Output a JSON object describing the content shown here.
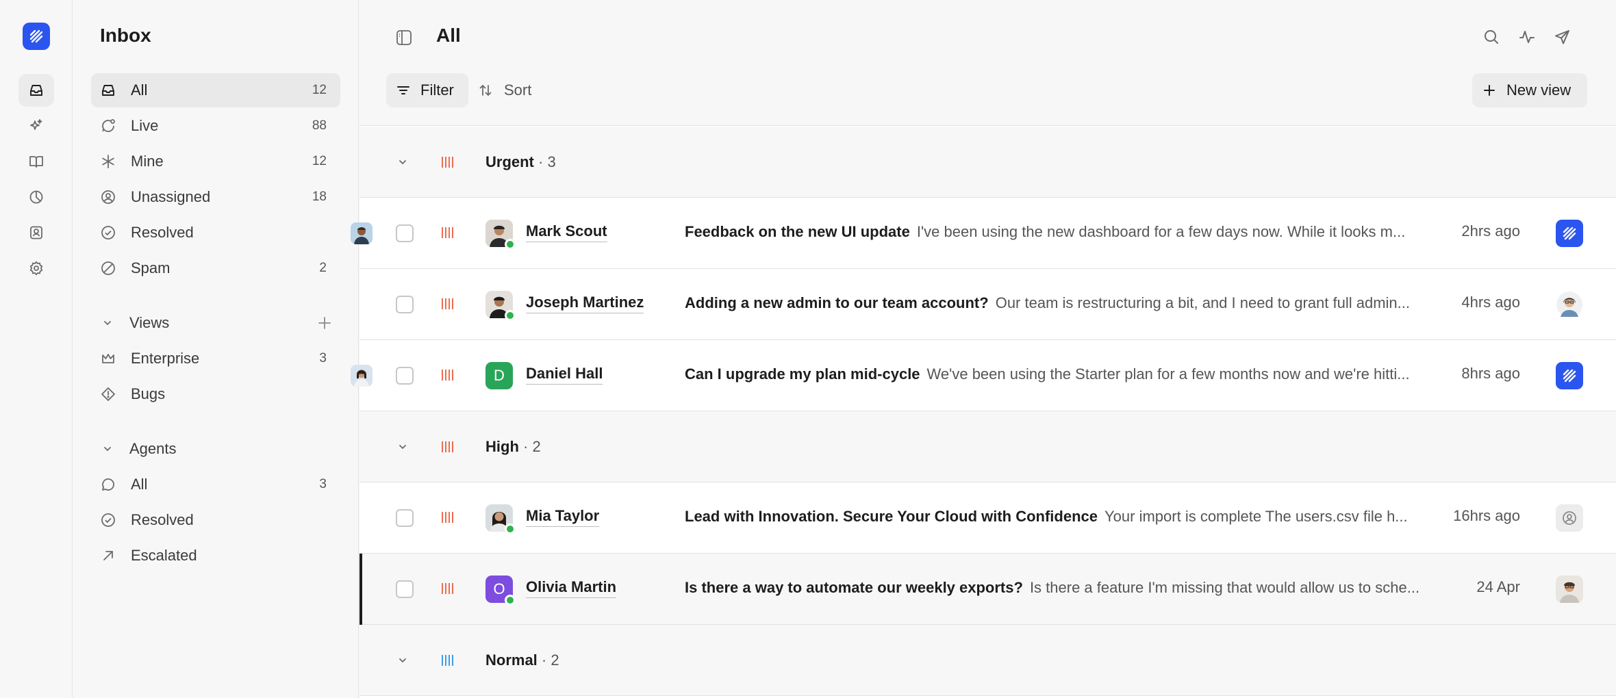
{
  "colors": {
    "brand": "#2b55ef",
    "urgent": "#ec6d4f",
    "normal": "#3aa0e8",
    "online": "#2fb24c",
    "avatar_green": "#29a55a",
    "avatar_purple": "#7c4ddf"
  },
  "rail": {
    "items": [
      {
        "icon": "inbox-icon",
        "active": true
      },
      {
        "icon": "sparkle-icon",
        "active": false
      },
      {
        "icon": "book-icon",
        "active": false
      },
      {
        "icon": "pie-chart-icon",
        "active": false
      },
      {
        "icon": "contact-icon",
        "active": false
      },
      {
        "icon": "gear-icon",
        "active": false
      }
    ]
  },
  "sidebar": {
    "title": "Inbox",
    "items": [
      {
        "label": "All",
        "count": "12",
        "icon": "inbox-icon",
        "active": true
      },
      {
        "label": "Live",
        "count": "88",
        "icon": "live-chat-icon"
      },
      {
        "label": "Mine",
        "count": "12",
        "icon": "asterisk-icon"
      },
      {
        "label": "Unassigned",
        "count": "18",
        "icon": "user-circle-icon"
      },
      {
        "label": "Resolved",
        "count": "",
        "icon": "check-circle-icon"
      },
      {
        "label": "Spam",
        "count": "2",
        "icon": "block-icon"
      }
    ],
    "views": {
      "label": "Views",
      "items": [
        {
          "label": "Enterprise",
          "count": "3",
          "icon": "crown-icon"
        },
        {
          "label": "Bugs",
          "count": "",
          "icon": "bug-diamond-icon"
        }
      ]
    },
    "agents": {
      "label": "Agents",
      "items": [
        {
          "label": "All",
          "count": "3",
          "icon": "chat-bubble-icon"
        },
        {
          "label": "Resolved",
          "count": "",
          "icon": "check-circle-icon"
        },
        {
          "label": "Escalated",
          "count": "",
          "icon": "arrow-up-right-icon"
        }
      ]
    }
  },
  "main": {
    "title": "All",
    "filter_label": "Filter",
    "sort_label": "Sort",
    "new_view_label": "New view",
    "groups": [
      {
        "name": "Urgent",
        "count": "· 3"
      },
      {
        "name": "High",
        "count": "· 2"
      },
      {
        "name": "Normal",
        "count": "· 2"
      }
    ],
    "conversations": [
      {
        "name": "Mark Scout",
        "subject": "Feedback on the new UI update",
        "preview": "I've been using the new dashboard for a few days now. While it looks m...",
        "time": "2hrs ago",
        "avatar": "photo",
        "online": true
      },
      {
        "name": "Joseph Martinez",
        "subject": "Adding a new admin to our team account?",
        "preview": "Our team is restructuring a bit, and I need to grant full admin...",
        "time": "4hrs ago",
        "avatar": "photo",
        "online": true
      },
      {
        "name": "Daniel Hall",
        "subject": "Can I upgrade my plan mid-cycle",
        "preview": "We've been using the Starter plan for a few months now and we're hitti...",
        "time": "8hrs ago",
        "avatar": "letter",
        "initial": "D",
        "online": false
      },
      {
        "name": "Mia Taylor",
        "subject": "Lead with Innovation. Secure Your Cloud with Confidence",
        "preview": "Your import is complete The users.csv file h...",
        "time": "16hrs ago",
        "avatar": "photo",
        "online": true
      },
      {
        "name": "Olivia Martin",
        "subject": "Is there a way to automate our weekly exports?",
        "preview": "Is there a feature I'm missing that would allow us to sche...",
        "time": "24 Apr",
        "avatar": "letter",
        "initial": "O",
        "online": true
      }
    ]
  }
}
